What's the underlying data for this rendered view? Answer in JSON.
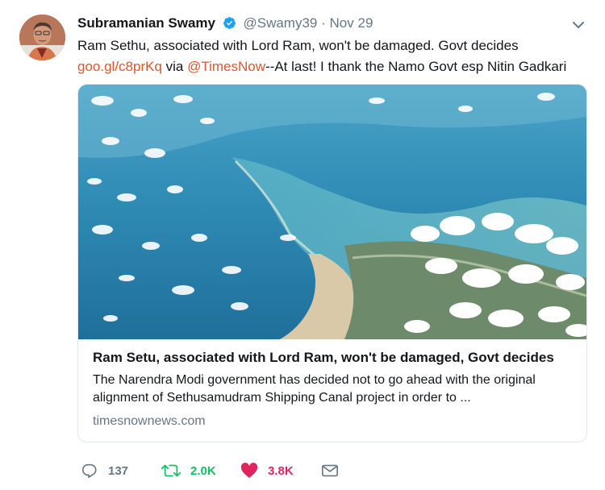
{
  "author": {
    "name": "Subramanian Swamy",
    "handle": "@Swamy39",
    "separator": "·",
    "time": "Nov 29"
  },
  "tweet": {
    "text_part1": "Ram Sethu, associated with Lord Ram, won't be damaged. Govt decides ",
    "link1": "goo.gl/c8prKq",
    "text_part2": " via ",
    "mention": "@TimesNow",
    "text_part3": "--At last! I thank the Namo Govt esp Nitin Gadkari"
  },
  "card": {
    "title": "Ram Setu, associated with Lord Ram, won't be damaged, Govt decides",
    "description": "The Narendra Modi government has decided not to go ahead with the original alignment of Sethusamudram Shipping Canal project in order to ...",
    "domain": "timesnownews.com"
  },
  "actions": {
    "replies": "137",
    "retweets": "2.0K",
    "likes": "3.8K"
  },
  "colors": {
    "link": "#e0542c",
    "retweet_active": "#17bf63",
    "like_active": "#e0245e",
    "verified": "#1da1f2"
  },
  "icons": [
    "verified-badge-icon",
    "chevron-down-icon",
    "reply-icon",
    "retweet-icon",
    "heart-icon",
    "envelope-icon"
  ]
}
